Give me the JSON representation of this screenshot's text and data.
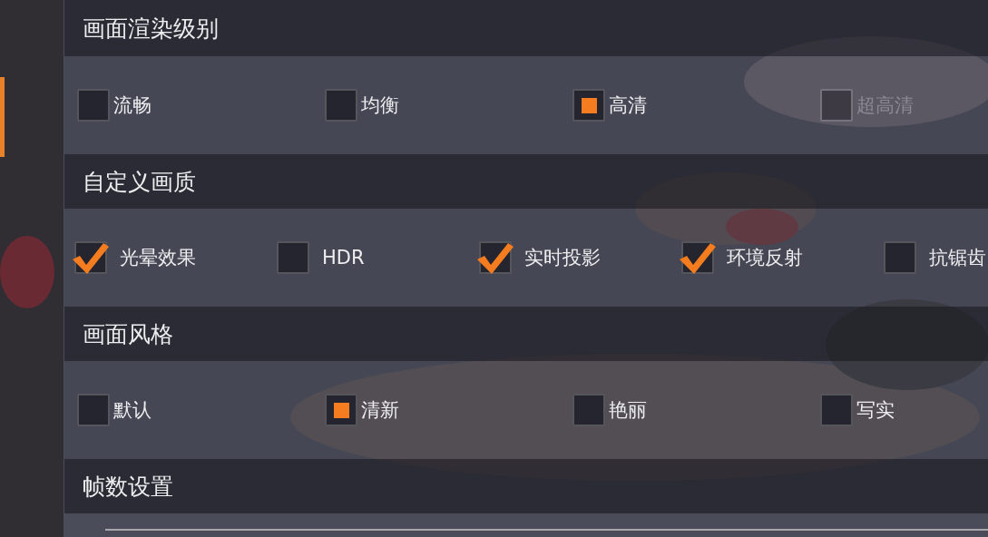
{
  "sections": [
    {
      "title": "画面渲染级别",
      "kind": "radio",
      "options": [
        {
          "label": "流畅",
          "selected": false,
          "disabled": false
        },
        {
          "label": "均衡",
          "selected": false,
          "disabled": false
        },
        {
          "label": "高清",
          "selected": true,
          "disabled": false
        },
        {
          "label": "超高清",
          "selected": false,
          "disabled": true
        }
      ]
    },
    {
      "title": "自定义画质",
      "kind": "checkbox",
      "options": [
        {
          "label": "光晕效果",
          "checked": true
        },
        {
          "label": "HDR",
          "checked": false
        },
        {
          "label": "实时投影",
          "checked": true
        },
        {
          "label": "环境反射",
          "checked": true
        },
        {
          "label": "抗锯齿",
          "checked": false
        }
      ]
    },
    {
      "title": "画面风格",
      "kind": "radio",
      "options": [
        {
          "label": "默认",
          "selected": false,
          "disabled": false
        },
        {
          "label": "清新",
          "selected": true,
          "disabled": false
        },
        {
          "label": "艳丽",
          "selected": false,
          "disabled": false
        },
        {
          "label": "写实",
          "selected": false,
          "disabled": false
        }
      ]
    },
    {
      "title": "帧数设置"
    }
  ]
}
